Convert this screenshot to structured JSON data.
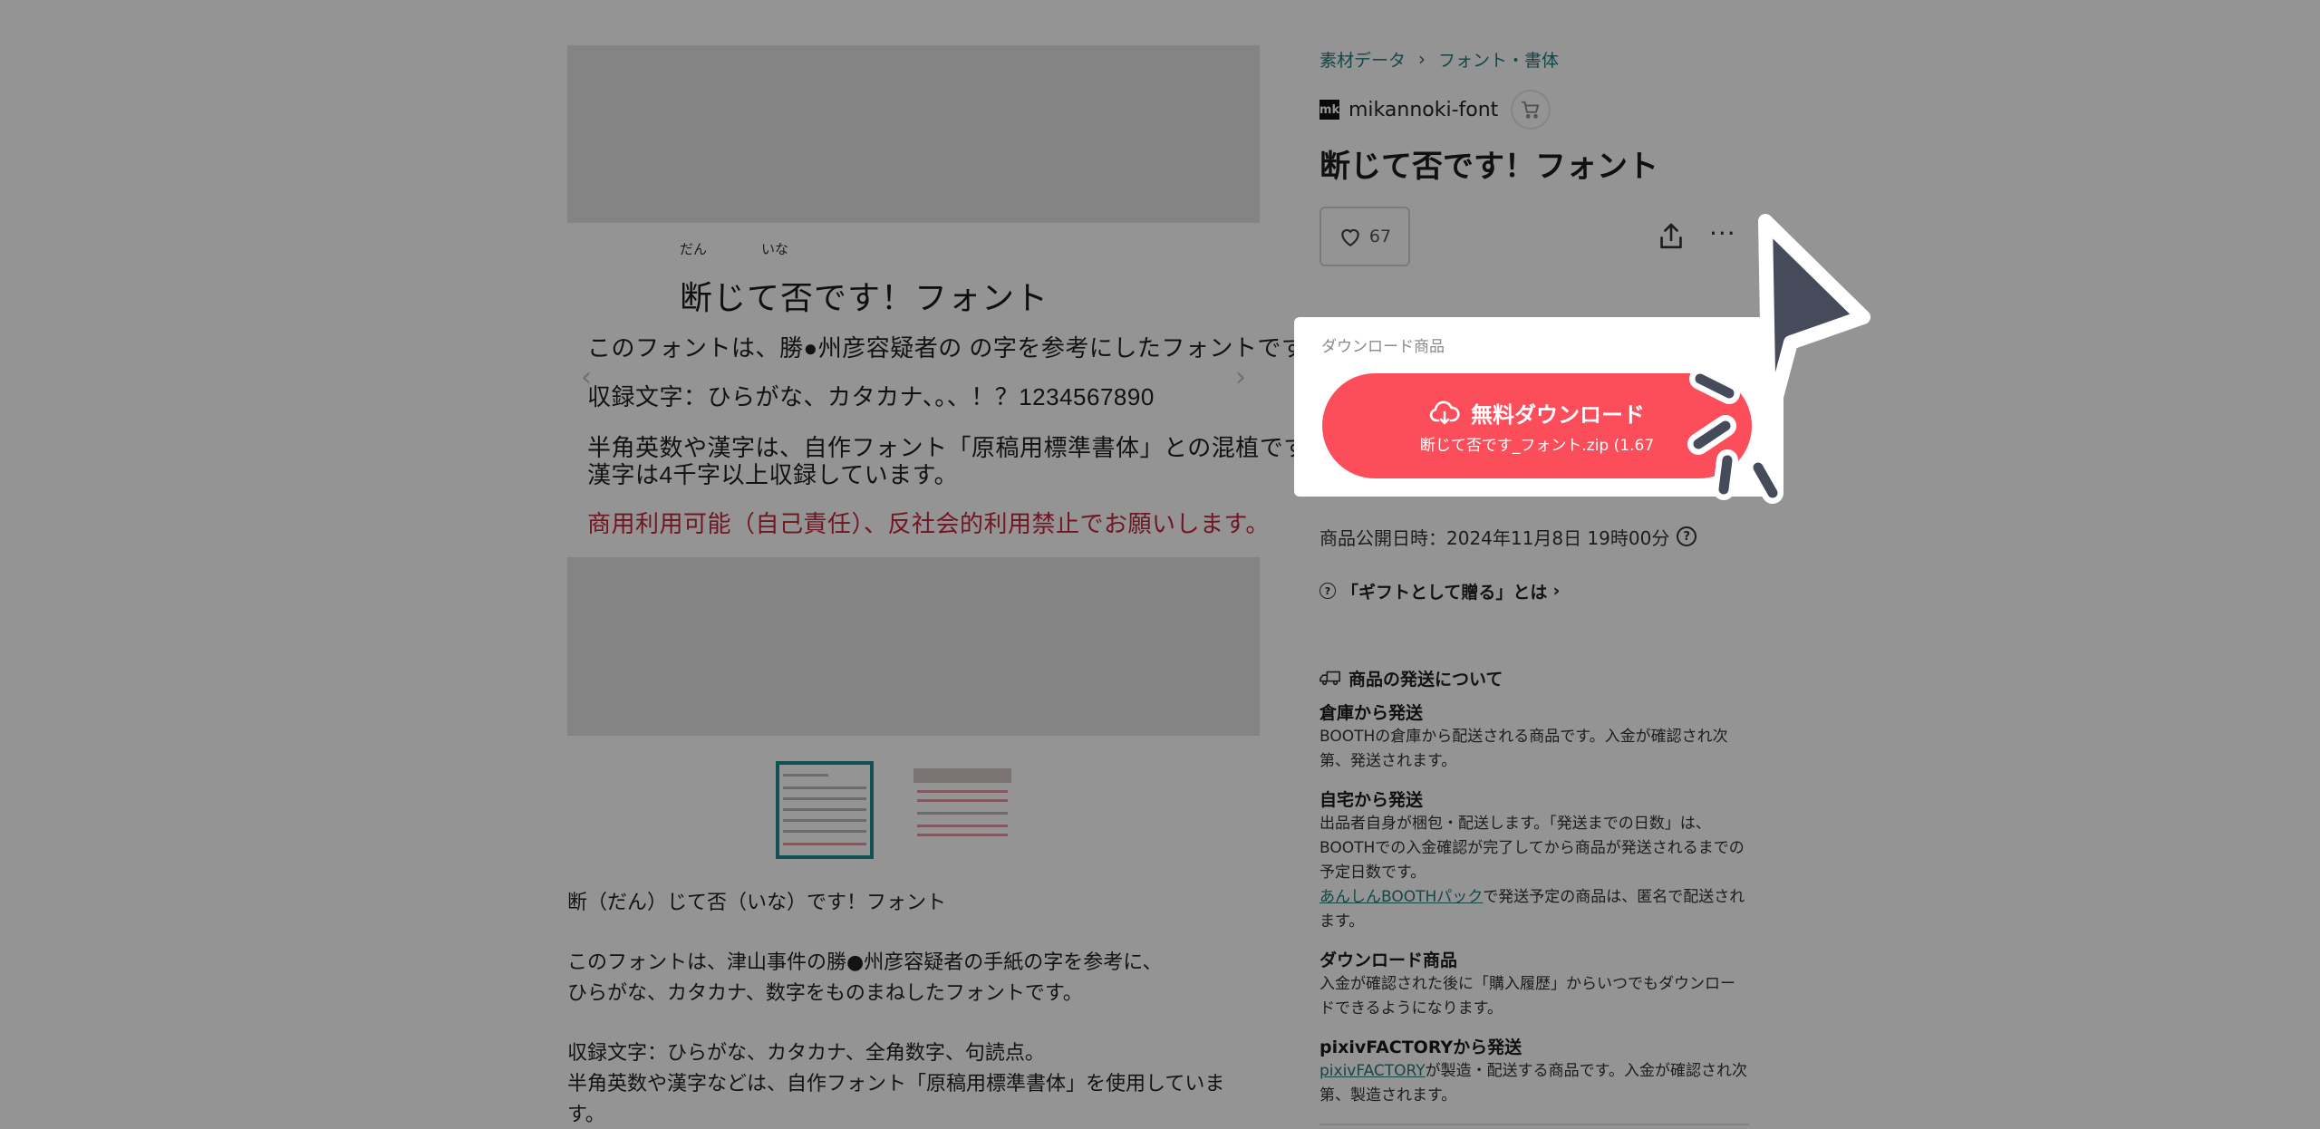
{
  "gallery": {
    "image": {
      "title": "断じて否です！フォント",
      "ruby_dan": "だん",
      "ruby_ina": "いな",
      "lines": [
        "このフォントは、勝●州彦容疑者の の字を参考にしたフォントです。",
        "収録文字：ひらがな、カタカナ、。、！？1234567890",
        "半角英数や漢字は、自作フォント「原稿用標準書体」との混植です。",
        "漢字は4千字以上収録しています。",
        "商用利用可能（自己責任）、反社会的利用禁止でお願いします。"
      ],
      "prev_arrow": "‹",
      "next_arrow": "›"
    }
  },
  "description": {
    "paragraphs": [
      [
        "断（だん）じて否（いな）です！フォント"
      ],
      [
        "このフォントは、津山事件の勝●州彦容疑者の手紙の字を参考に、",
        "ひらがな、カタカナ、数字をものまねしたフォントです。"
      ],
      [
        "収録文字：ひらがな、カタカナ、全角数字、句読点。",
        "半角英数や漢字などは、自作フォント「原稿用標準書体」を使用していま",
        "す。"
      ]
    ]
  },
  "side": {
    "breadcrumb": [
      "素材データ",
      "フォント・書体"
    ],
    "breadcrumb_sep": "›",
    "shop_logo": "mk",
    "shop_name": "mikannoki-font",
    "product_title": "断じて否です！フォント",
    "likes": "67",
    "more": "···"
  },
  "download": {
    "label": "ダウンロード商品",
    "button_main": "無料ダウンロード",
    "button_sub": "断じて否です_フォント.zip (1.67"
  },
  "meta": {
    "pub_date": "商品公開日時：2024年11月8日 19時00分",
    "gift": "「ギフトとして贈る」とは",
    "gift_chevron": "›",
    "question": "?"
  },
  "shipping": {
    "heading": "商品の発送について",
    "items": [
      {
        "title": "倉庫から発送",
        "body": "BOOTHの倉庫から配送される商品です。入金が確認され次第、発送されます。"
      },
      {
        "title": "自宅から発送",
        "body": "出品者自身が梱包・配送します。「発送までの日数」は、BOOTHでの入金確認が完了してから商品が発送されるまでの予定日数です。",
        "link": "あんしんBOOTHパック",
        "link_after": "で発送予定の商品は、匿名で配送されます。"
      },
      {
        "title": "ダウンロード商品",
        "body": "入金が確認された後に「購入履歴」からいつでもダウンロードできるようになります。"
      },
      {
        "title": "pixivFACTORYから発送",
        "link": "pixivFACTORY",
        "link_after": "が製造・配送する商品です。入金が確認され次第、製造されます。"
      }
    ]
  },
  "colors": {
    "accent_teal": "#217a80",
    "download_red": "#fc4d5a",
    "cursor_fill": "#454b5a"
  }
}
